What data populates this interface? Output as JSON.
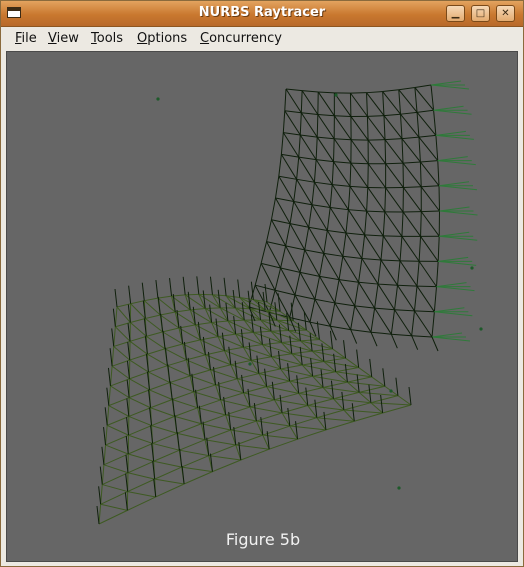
{
  "window": {
    "title": "NURBS Raytracer"
  },
  "titlebar_buttons": {
    "minimize": "▁",
    "maximize": "□",
    "close": "✕"
  },
  "menu": [
    {
      "label": "File"
    },
    {
      "label": "View"
    },
    {
      "label": "Tools"
    },
    {
      "label": "Options"
    },
    {
      "label": "Concurrency"
    }
  ],
  "viewport": {
    "background": "#666666",
    "caption": "Figure 5b",
    "wire_color_back": "#0f1f0c",
    "wire_color_seat": "#3e5a22",
    "wire_color_edge": "#2f7a3a"
  }
}
